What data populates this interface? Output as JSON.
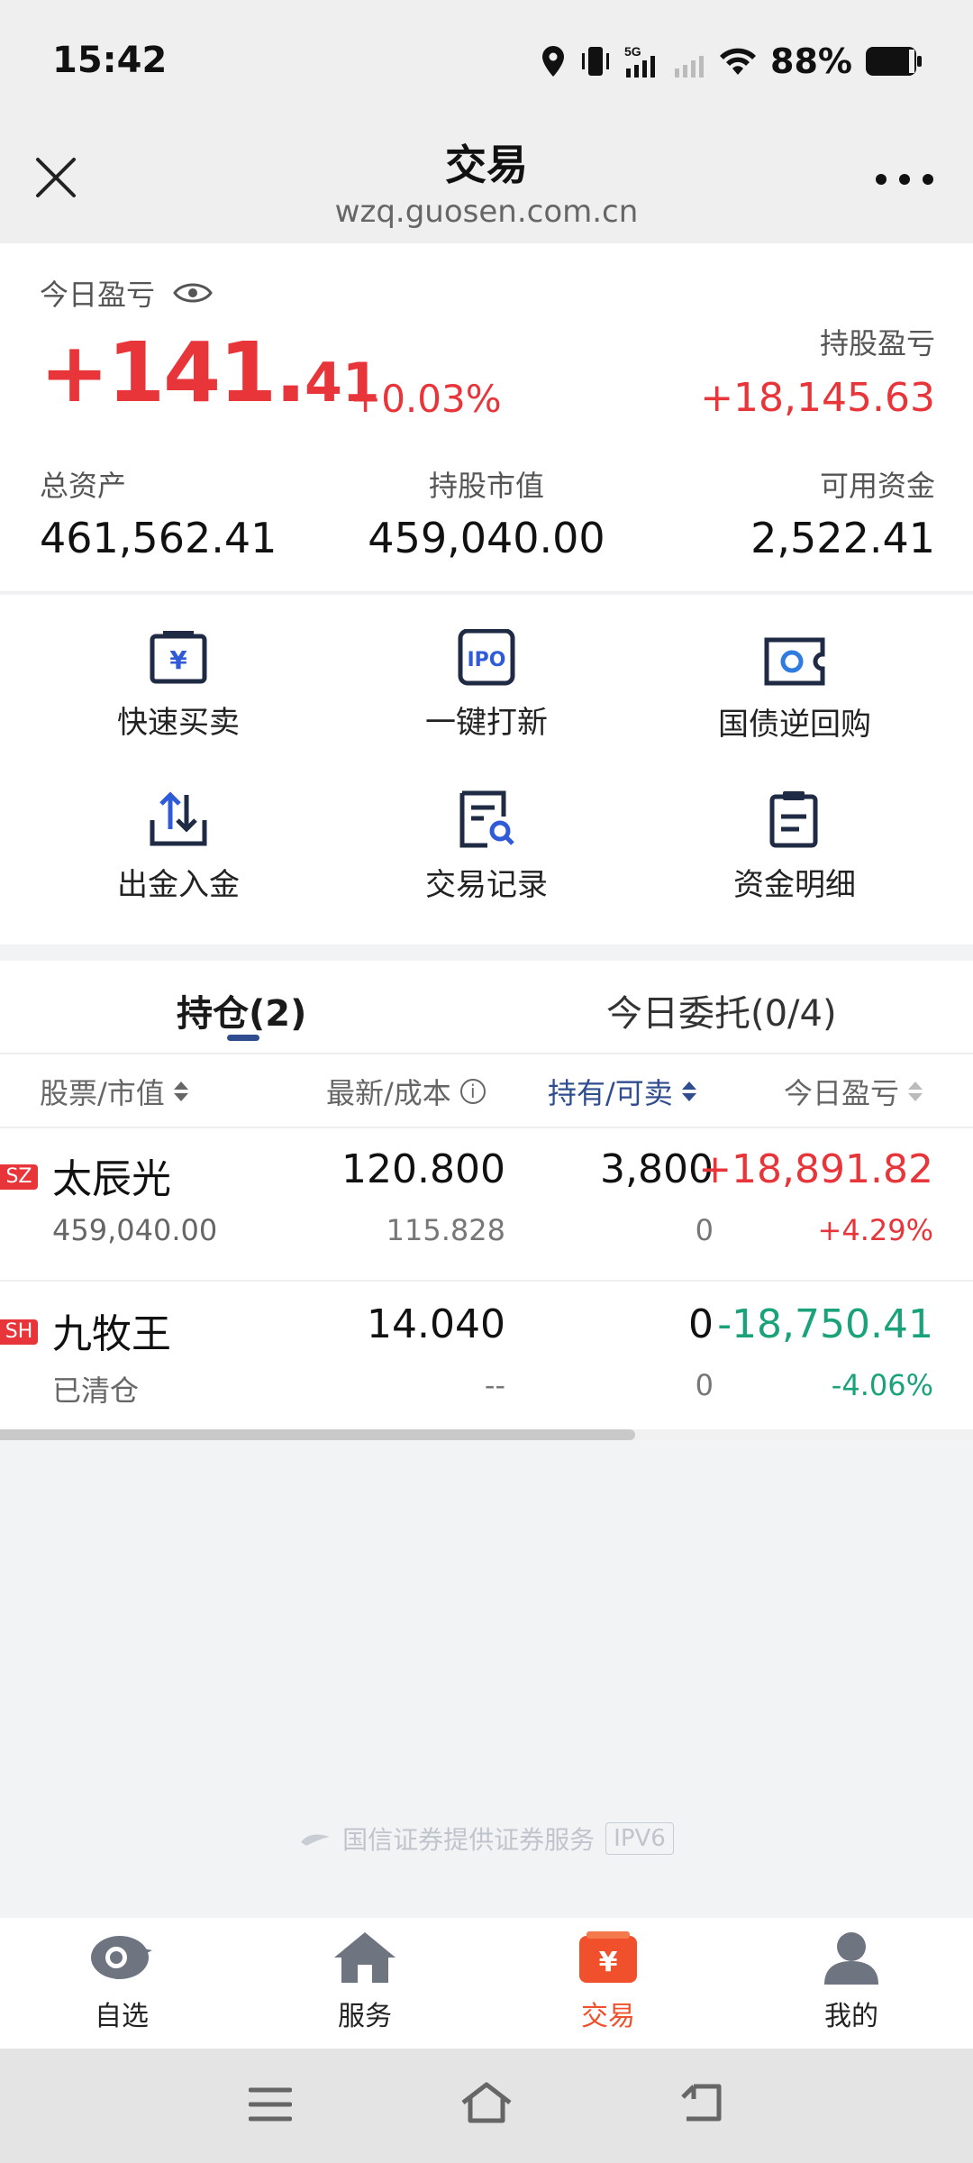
{
  "status_bar": {
    "time": "15:42",
    "battery": "88%"
  },
  "header": {
    "title": "交易",
    "url": "wzq.guosen.com.cn"
  },
  "summary": {
    "today_label": "今日盈亏",
    "today_int": "+141.",
    "today_dec": "41",
    "today_pct": "+0.03%",
    "holding_label": "持股盈亏",
    "holding_value": "+18,145.63",
    "total_assets_label": "总资产",
    "total_assets_value": "461,562.41",
    "market_value_label": "持股市值",
    "market_value_value": "459,040.00",
    "available_label": "可用资金",
    "available_value": "2,522.41"
  },
  "actions": [
    {
      "label": "快速买卖",
      "icon": "yuan-card-icon"
    },
    {
      "label": "一键打新",
      "icon": "ipo-icon"
    },
    {
      "label": "国债逆回购",
      "icon": "bond-ticket-icon"
    },
    {
      "label": "出金入金",
      "icon": "transfer-arrows-icon"
    },
    {
      "label": "交易记录",
      "icon": "record-search-icon"
    },
    {
      "label": "资金明细",
      "icon": "clipboard-icon"
    }
  ],
  "tabs": {
    "holdings": "持仓(2)",
    "orders": "今日委托(0/4)"
  },
  "columns": {
    "stock": "股票/市值",
    "price": "最新/成本",
    "position": "持有/可卖",
    "pnl": "今日盈亏"
  },
  "rows": [
    {
      "market": "SZ",
      "name": "太辰光",
      "sub": "459,040.00",
      "price": "120.800",
      "cost": "115.828",
      "hold": "3,800",
      "sellable": "0",
      "pnl": "+18,891.82",
      "pnl_pct": "+4.29%"
    },
    {
      "market": "SH",
      "name": "九牧王",
      "sub": "已清仓",
      "price": "14.040",
      "cost": "--",
      "hold": "0",
      "sellable": "0",
      "pnl": "-18,750.41",
      "pnl_pct": "-4.06%"
    }
  ],
  "footer": {
    "note": "国信证券提供证券服务",
    "badge": "IPV6"
  },
  "nav": [
    {
      "label": "自选",
      "icon": "watchlist-icon"
    },
    {
      "label": "服务",
      "icon": "home-icon"
    },
    {
      "label": "交易",
      "icon": "trade-icon"
    },
    {
      "label": "我的",
      "icon": "profile-icon"
    }
  ],
  "colors": {
    "red": "#e8353a",
    "green": "#1aa37a",
    "accent": "#f0502b",
    "blue": "#2f4d8f"
  }
}
